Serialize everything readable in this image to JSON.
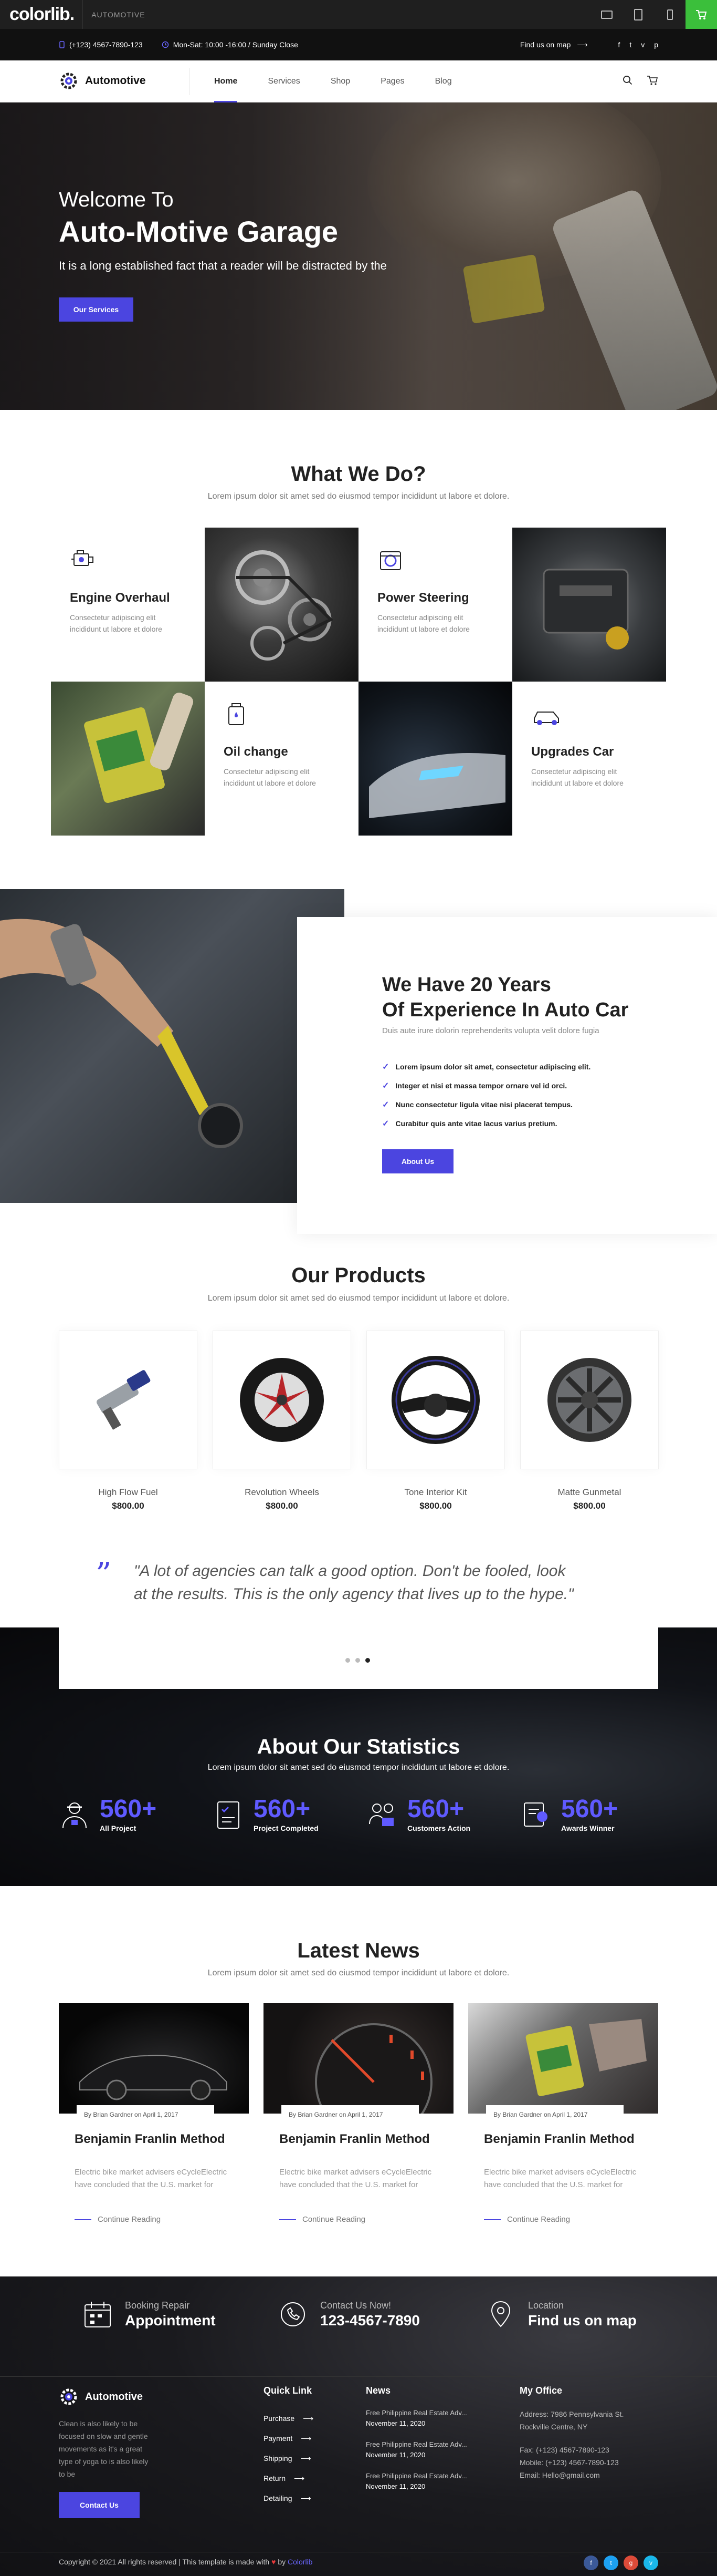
{
  "colorlib": {
    "logo": "colorlib.",
    "theme_name": "AUTOMOTIVE"
  },
  "topbar": {
    "phone": "(+123) 4567-7890-123",
    "hours": "Mon-Sat: 10:00 -16:00 / Sunday Close",
    "map_link": "Find us on map",
    "social": [
      "f",
      "t",
      "v",
      "p"
    ]
  },
  "nav": {
    "brand": "Automotive",
    "items": [
      "Home",
      "Services",
      "Shop",
      "Pages",
      "Blog"
    ],
    "active": "Home"
  },
  "hero": {
    "subtitle": "Welcome To",
    "title": "Auto-Motive Garage",
    "text": "It is a long established fact that a reader will be distracted by the",
    "button": "Our Services"
  },
  "services": {
    "title": "What We Do?",
    "subtitle": "Lorem ipsum dolor sit amet sed do eiusmod tempor incididunt ut labore et dolore.",
    "items": [
      {
        "name": "Engine Overhaul",
        "desc": "Consectetur adipiscing elit incididunt ut labore et dolore",
        "icon": "engine-icon"
      },
      {
        "name": "Power Steering",
        "desc": "Consectetur adipiscing elit incididunt ut labore et dolore",
        "icon": "steering-icon"
      },
      {
        "name": "Oil change",
        "desc": "Consectetur adipiscing elit incididunt ut labore et dolore",
        "icon": "oil-icon"
      },
      {
        "name": "Upgrades Car",
        "desc": "Consectetur adipiscing elit incididunt ut labore et dolore",
        "icon": "car-icon"
      }
    ]
  },
  "about": {
    "title_line1": "We Have 20 Years",
    "title_line2": "Of Experience In Auto Car",
    "desc": "Duis aute irure dolorin reprehenderits volupta velit dolore fugia",
    "checks": [
      "Lorem ipsum dolor sit amet, consectetur adipiscing elit.",
      "Integer et nisi et massa tempor ornare vel id orci.",
      "Nunc consectetur ligula vitae nisi placerat tempus.",
      "Curabitur quis ante vitae lacus varius pretium."
    ],
    "button": "About Us"
  },
  "products": {
    "title": "Our Products",
    "subtitle": "Lorem ipsum dolor sit amet sed do eiusmod tempor incididunt ut labore et dolore.",
    "items": [
      {
        "name": "High Flow Fuel",
        "price": "$800.00"
      },
      {
        "name": "Revolution Wheels",
        "price": "$800.00"
      },
      {
        "name": "Tone Interior Kit",
        "price": "$800.00"
      },
      {
        "name": "Matte Gunmetal",
        "price": "$800.00"
      }
    ]
  },
  "testimonial": {
    "quote": "\"A lot of agencies can talk a good option. Don't be fooled, look at the results. This is the only agency that lives up to the hype.\"",
    "active_dot": 3
  },
  "stats": {
    "title": "About Our Statistics",
    "subtitle": "Lorem ipsum dolor sit amet sed do eiusmod tempor incididunt ut labore et dolore.",
    "items": [
      {
        "value": "560+",
        "label": "All Project"
      },
      {
        "value": "560+",
        "label": "Project Completed"
      },
      {
        "value": "560+",
        "label": "Customers Action"
      },
      {
        "value": "560+",
        "label": "Awards Winner"
      }
    ]
  },
  "news": {
    "title": "Latest News",
    "subtitle": "Lorem ipsum dolor sit amet sed do eiusmod tempor incididunt ut labore et dolore.",
    "items": [
      {
        "meta": "By Brian Gardner on April 1, 2017",
        "title": "Benjamin Franlin Method",
        "desc": "Electric bike market advisers eCycleElectric have concluded that the U.S. market for",
        "more": "Continue Reading"
      },
      {
        "meta": "By Brian Gardner on April 1, 2017",
        "title": "Benjamin Franlin Method",
        "desc": "Electric bike market advisers eCycleElectric have concluded that the U.S. market for",
        "more": "Continue Reading"
      },
      {
        "meta": "By Brian Gardner on April 1, 2017",
        "title": "Benjamin Franlin Method",
        "desc": "Electric bike market advisers eCycleElectric have concluded that the U.S. market for",
        "more": "Continue Reading"
      }
    ]
  },
  "footer": {
    "contacts": [
      {
        "label": "Booking Repair",
        "value": "Appointment"
      },
      {
        "label": "Contact Us Now!",
        "value": "123-4567-7890"
      },
      {
        "label": "Location",
        "value": "Find us on map"
      }
    ],
    "brand": "Automotive",
    "desc": "Clean is also likely to be focused on slow and gentle movements as it's a great type of yoga to is also likely to be",
    "button": "Contact Us",
    "quick_title": "Quick Link",
    "quick_links": [
      "Purchase",
      "Payment",
      "Shipping",
      "Return",
      "Detailing"
    ],
    "news_title": "News",
    "news": [
      {
        "title": "Free Philippine Real Estate Adv...",
        "date": "November 11, 2020"
      },
      {
        "title": "Free Philippine Real Estate Adv...",
        "date": "November 11, 2020"
      },
      {
        "title": "Free Philippine Real Estate Adv...",
        "date": "November 11, 2020"
      }
    ],
    "office_title": "My Office",
    "office_address1": "Address: 7986 Pennsylvania St.",
    "office_address2": "Rockville Centre, NY",
    "office_fax": "Fax: (+123) 4567-7890-123",
    "office_mobile": "Mobile: (+123) 4567-7890-123",
    "office_email": "Email: Hello@gmail.com",
    "copyright": "Copyright © 2021 All rights reserved | This template is made with",
    "copyright_by": "by",
    "copyright_brand": "Colorlib",
    "social": [
      "f",
      "t",
      "g",
      "v"
    ]
  },
  "colors": {
    "accent": "#4b45e0",
    "cart_green": "#3bbf3b",
    "dark": "#111111"
  }
}
